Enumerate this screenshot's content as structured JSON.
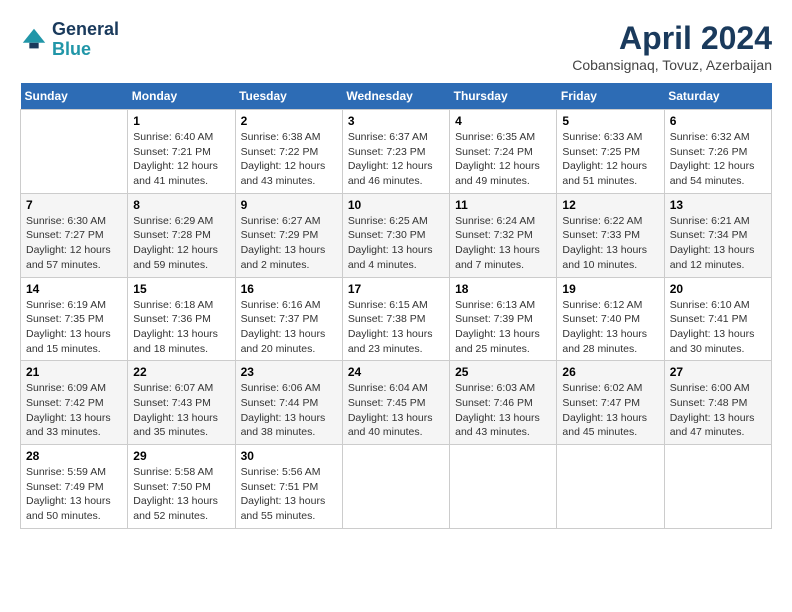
{
  "header": {
    "logo_line1": "General",
    "logo_line2": "Blue",
    "month": "April 2024",
    "location": "Cobansignaq, Tovuz, Azerbaijan"
  },
  "weekdays": [
    "Sunday",
    "Monday",
    "Tuesday",
    "Wednesday",
    "Thursday",
    "Friday",
    "Saturday"
  ],
  "weeks": [
    [
      null,
      {
        "day": 1,
        "sunrise": "6:40 AM",
        "sunset": "7:21 PM",
        "daylight": "12 hours and 41 minutes."
      },
      {
        "day": 2,
        "sunrise": "6:38 AM",
        "sunset": "7:22 PM",
        "daylight": "12 hours and 43 minutes."
      },
      {
        "day": 3,
        "sunrise": "6:37 AM",
        "sunset": "7:23 PM",
        "daylight": "12 hours and 46 minutes."
      },
      {
        "day": 4,
        "sunrise": "6:35 AM",
        "sunset": "7:24 PM",
        "daylight": "12 hours and 49 minutes."
      },
      {
        "day": 5,
        "sunrise": "6:33 AM",
        "sunset": "7:25 PM",
        "daylight": "12 hours and 51 minutes."
      },
      {
        "day": 6,
        "sunrise": "6:32 AM",
        "sunset": "7:26 PM",
        "daylight": "12 hours and 54 minutes."
      }
    ],
    [
      {
        "day": 7,
        "sunrise": "6:30 AM",
        "sunset": "7:27 PM",
        "daylight": "12 hours and 57 minutes."
      },
      {
        "day": 8,
        "sunrise": "6:29 AM",
        "sunset": "7:28 PM",
        "daylight": "12 hours and 59 minutes."
      },
      {
        "day": 9,
        "sunrise": "6:27 AM",
        "sunset": "7:29 PM",
        "daylight": "13 hours and 2 minutes."
      },
      {
        "day": 10,
        "sunrise": "6:25 AM",
        "sunset": "7:30 PM",
        "daylight": "13 hours and 4 minutes."
      },
      {
        "day": 11,
        "sunrise": "6:24 AM",
        "sunset": "7:32 PM",
        "daylight": "13 hours and 7 minutes."
      },
      {
        "day": 12,
        "sunrise": "6:22 AM",
        "sunset": "7:33 PM",
        "daylight": "13 hours and 10 minutes."
      },
      {
        "day": 13,
        "sunrise": "6:21 AM",
        "sunset": "7:34 PM",
        "daylight": "13 hours and 12 minutes."
      }
    ],
    [
      {
        "day": 14,
        "sunrise": "6:19 AM",
        "sunset": "7:35 PM",
        "daylight": "13 hours and 15 minutes."
      },
      {
        "day": 15,
        "sunrise": "6:18 AM",
        "sunset": "7:36 PM",
        "daylight": "13 hours and 18 minutes."
      },
      {
        "day": 16,
        "sunrise": "6:16 AM",
        "sunset": "7:37 PM",
        "daylight": "13 hours and 20 minutes."
      },
      {
        "day": 17,
        "sunrise": "6:15 AM",
        "sunset": "7:38 PM",
        "daylight": "13 hours and 23 minutes."
      },
      {
        "day": 18,
        "sunrise": "6:13 AM",
        "sunset": "7:39 PM",
        "daylight": "13 hours and 25 minutes."
      },
      {
        "day": 19,
        "sunrise": "6:12 AM",
        "sunset": "7:40 PM",
        "daylight": "13 hours and 28 minutes."
      },
      {
        "day": 20,
        "sunrise": "6:10 AM",
        "sunset": "7:41 PM",
        "daylight": "13 hours and 30 minutes."
      }
    ],
    [
      {
        "day": 21,
        "sunrise": "6:09 AM",
        "sunset": "7:42 PM",
        "daylight": "13 hours and 33 minutes."
      },
      {
        "day": 22,
        "sunrise": "6:07 AM",
        "sunset": "7:43 PM",
        "daylight": "13 hours and 35 minutes."
      },
      {
        "day": 23,
        "sunrise": "6:06 AM",
        "sunset": "7:44 PM",
        "daylight": "13 hours and 38 minutes."
      },
      {
        "day": 24,
        "sunrise": "6:04 AM",
        "sunset": "7:45 PM",
        "daylight": "13 hours and 40 minutes."
      },
      {
        "day": 25,
        "sunrise": "6:03 AM",
        "sunset": "7:46 PM",
        "daylight": "13 hours and 43 minutes."
      },
      {
        "day": 26,
        "sunrise": "6:02 AM",
        "sunset": "7:47 PM",
        "daylight": "13 hours and 45 minutes."
      },
      {
        "day": 27,
        "sunrise": "6:00 AM",
        "sunset": "7:48 PM",
        "daylight": "13 hours and 47 minutes."
      }
    ],
    [
      {
        "day": 28,
        "sunrise": "5:59 AM",
        "sunset": "7:49 PM",
        "daylight": "13 hours and 50 minutes."
      },
      {
        "day": 29,
        "sunrise": "5:58 AM",
        "sunset": "7:50 PM",
        "daylight": "13 hours and 52 minutes."
      },
      {
        "day": 30,
        "sunrise": "5:56 AM",
        "sunset": "7:51 PM",
        "daylight": "13 hours and 55 minutes."
      },
      null,
      null,
      null,
      null
    ]
  ]
}
